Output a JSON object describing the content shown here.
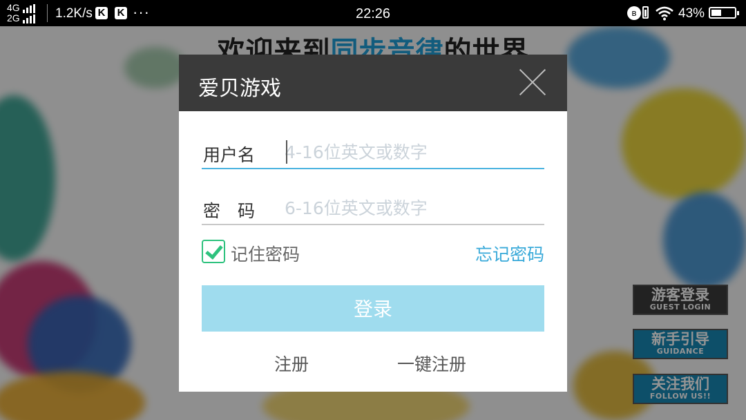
{
  "status_bar": {
    "net_top": "4G",
    "net_bottom": "2G",
    "speed": "1.2K/s",
    "app_icon_letter": "K",
    "dots": "···",
    "time": "22:26",
    "battery_percent": "43%",
    "battery_level": 0.43
  },
  "background": {
    "welcome_pre": "欢迎来到",
    "welcome_highlight": "同步音律",
    "welcome_post": "的世界",
    "side_buttons": [
      {
        "zh": "游客登录",
        "en": "GUEST LOGIN"
      },
      {
        "zh": "新手引导",
        "en": "GUIDANCE"
      },
      {
        "zh": "关注我们",
        "en": "FOLLOW US!!"
      }
    ]
  },
  "dialog": {
    "title": "爱贝游戏",
    "username_label": "用户名",
    "username_placeholder": "4-16位英文或数字",
    "password_label": "密　码",
    "password_placeholder": "6-16位英文或数字",
    "remember_label": "记住密码",
    "remember_checked": true,
    "forgot_label": "忘记密码",
    "login_label": "登录",
    "register_label": "注册",
    "quick_register_label": "一键注册"
  },
  "colors": {
    "accent": "#38a9d9",
    "login_button": "#9fdcee",
    "checkbox": "#2ec27e",
    "header": "#3a3a3a"
  }
}
